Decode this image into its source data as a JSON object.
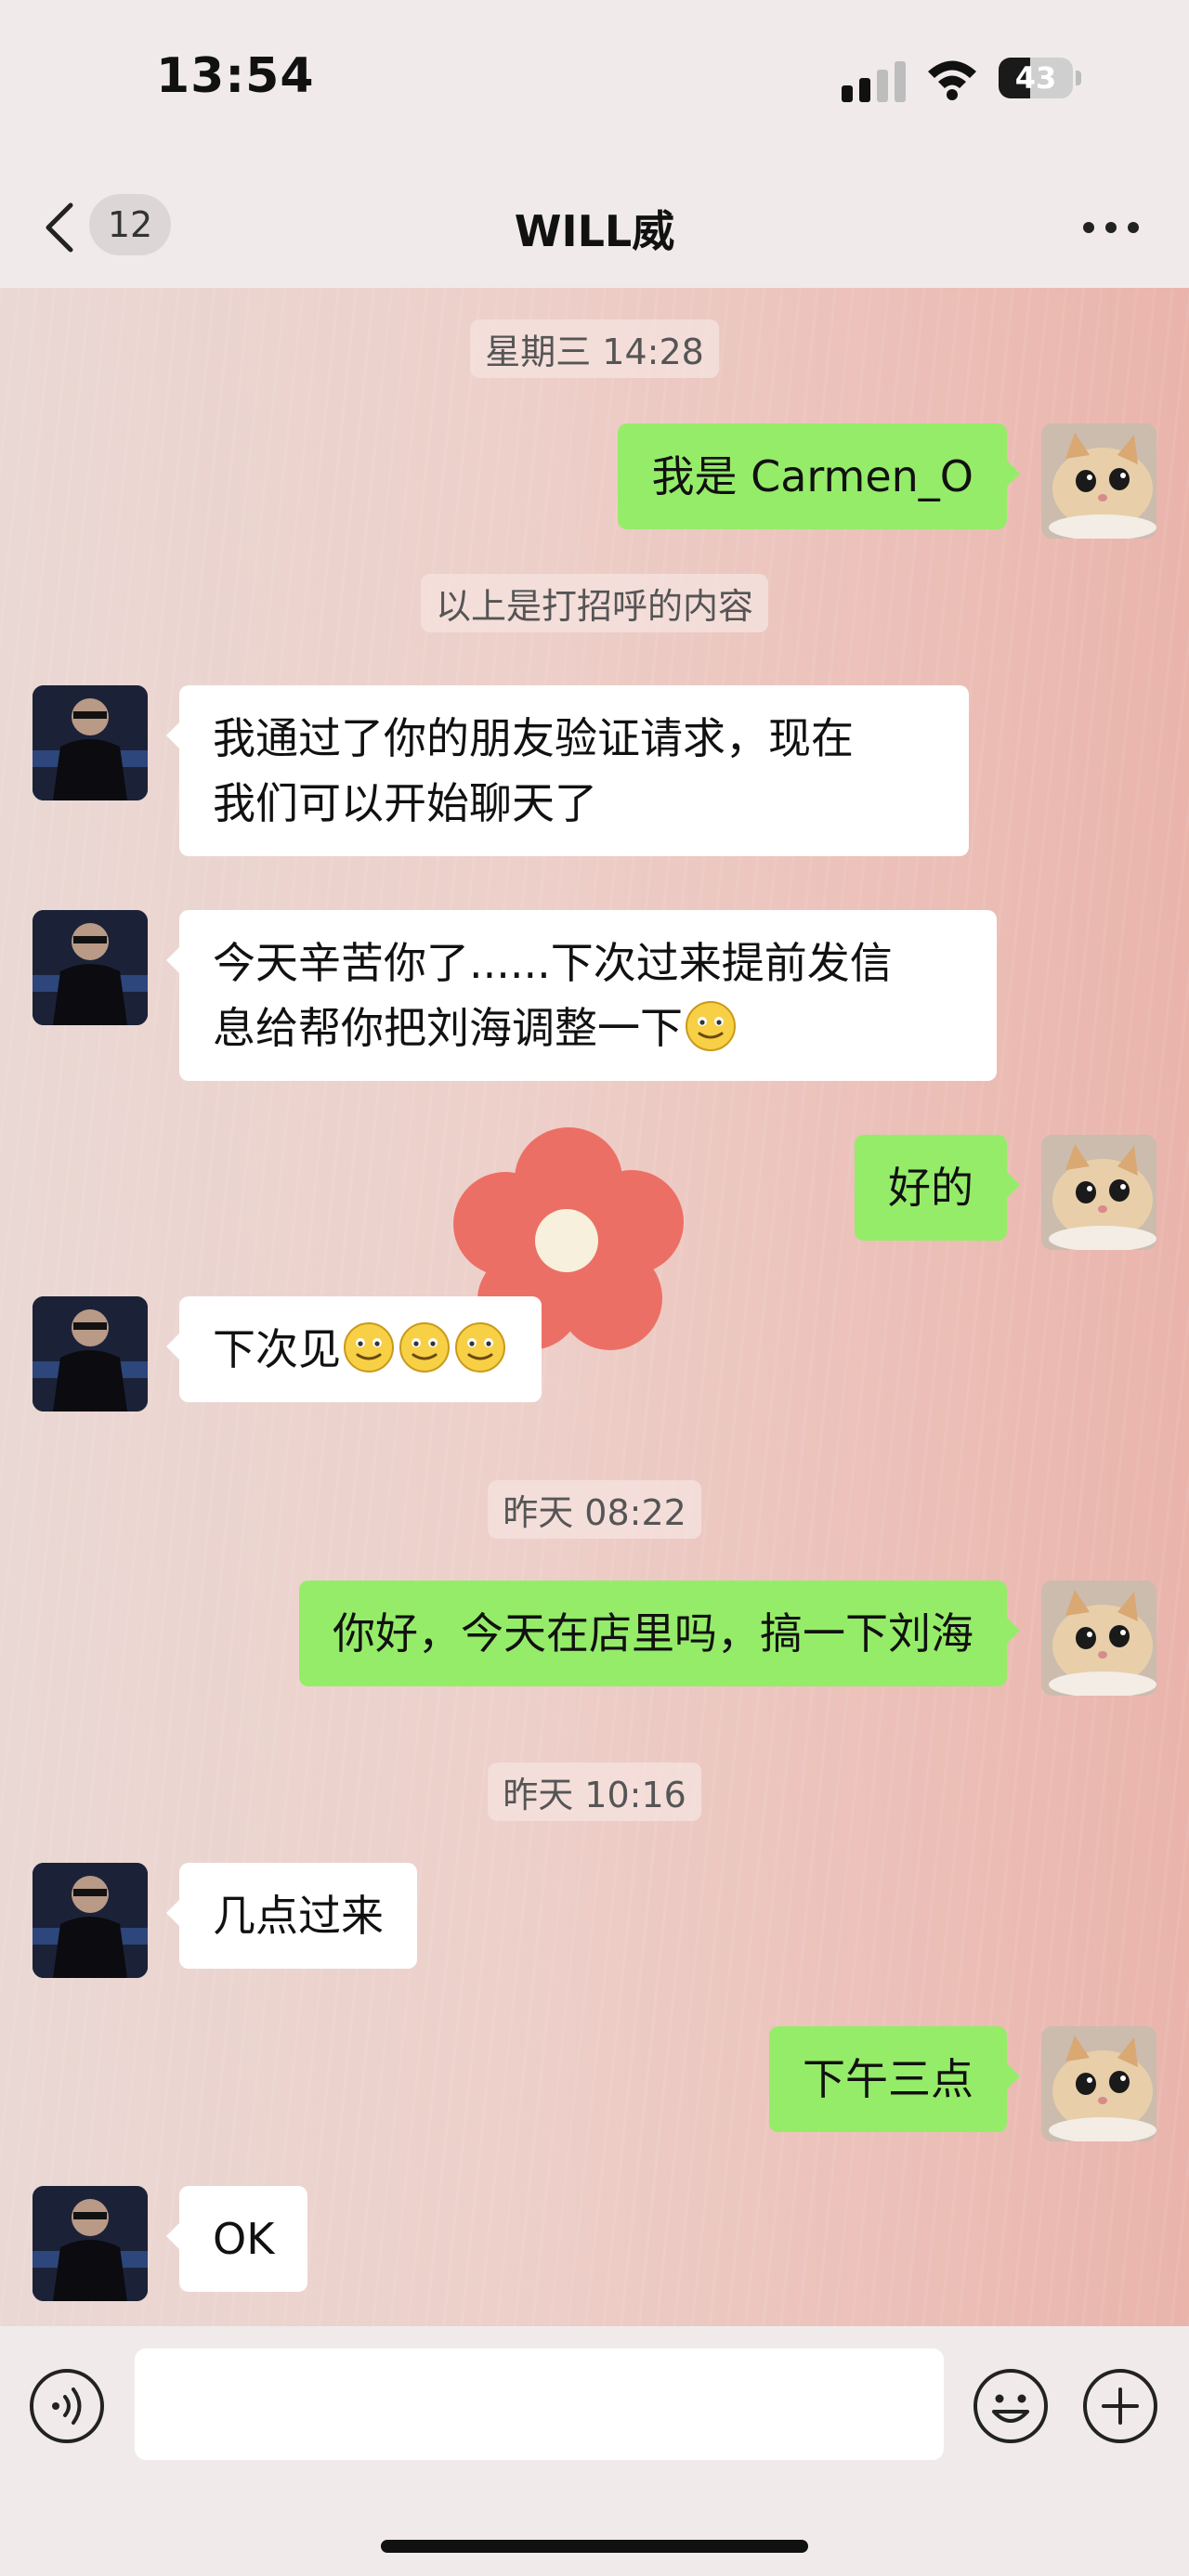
{
  "status_bar": {
    "time": "13:54",
    "battery_level": "43",
    "battery_fraction": 0.43
  },
  "header": {
    "back_icon": "chevron-left-icon",
    "unread_count": "12",
    "title": "WILL威",
    "more_icon": "ellipsis-icon"
  },
  "messages": [
    {
      "type": "timestamp",
      "text": "星期三 14:28"
    },
    {
      "type": "message",
      "sender": "me",
      "text": "我是 Carmen_O"
    },
    {
      "type": "system",
      "text": "以上是打招呼的内容"
    },
    {
      "type": "message",
      "sender": "other",
      "line1": "我通过了你的朋友验证请求，现在",
      "line2": "我们可以开始聊天了"
    },
    {
      "type": "message",
      "sender": "other",
      "line1": "今天辛苦你了......下次过来提前发信",
      "line2": "息给帮你把刘海调整一下",
      "emoji": "smile-emoji"
    },
    {
      "type": "message",
      "sender": "me",
      "text": "好的"
    },
    {
      "type": "message",
      "sender": "other",
      "text": "下次见",
      "emoji_count": 3,
      "emoji": "smile-emoji"
    },
    {
      "type": "timestamp",
      "text": "昨天 08:22"
    },
    {
      "type": "message",
      "sender": "me",
      "text": "你好，今天在店里吗，搞一下刘海"
    },
    {
      "type": "timestamp",
      "text": "昨天 10:16"
    },
    {
      "type": "message",
      "sender": "other",
      "text": "几点过来"
    },
    {
      "type": "message",
      "sender": "me",
      "text": "下午三点"
    },
    {
      "type": "message",
      "sender": "other",
      "text": "OK"
    }
  ],
  "input_bar": {
    "voice_icon": "voice-icon",
    "emoji_icon": "smile-face-icon",
    "plus_icon": "plus-circle-icon",
    "text_value": ""
  },
  "colors": {
    "my_bubble": "#95ec69",
    "other_bubble": "#ffffff",
    "bar_background": "#f0ebea"
  }
}
